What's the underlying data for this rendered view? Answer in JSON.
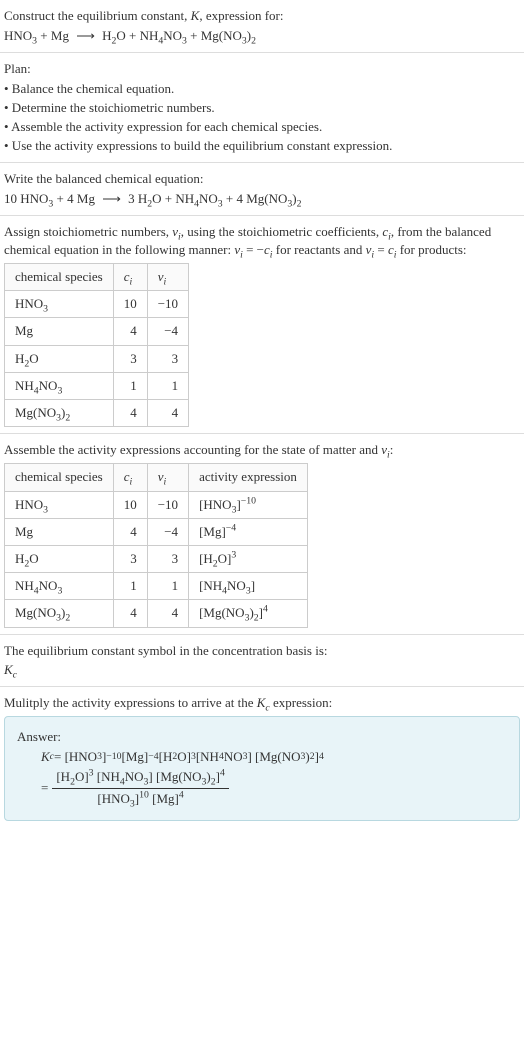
{
  "sec1": {
    "title_a": "Construct the equilibrium constant, ",
    "title_b": ", expression for:",
    "eq_lhs_1": "HNO",
    "eq_lhs_2": " + Mg ",
    "eq_rhs_1": " H",
    "eq_rhs_2": "O + NH",
    "eq_rhs_3": "NO",
    "eq_rhs_4": " + Mg(NO",
    "eq_rhs_5": ")"
  },
  "sec2": {
    "title": "Plan:",
    "b1": "• Balance the chemical equation.",
    "b2": "• Determine the stoichiometric numbers.",
    "b3": "• Assemble the activity expression for each chemical species.",
    "b4": "• Use the activity expressions to build the equilibrium constant expression."
  },
  "sec3": {
    "title": "Write the balanced chemical equation:",
    "eq_a": "10 HNO",
    "eq_b": " + 4 Mg ",
    "eq_c": " 3 H",
    "eq_d": "O + NH",
    "eq_e": "NO",
    "eq_f": " + 4 Mg(NO",
    "eq_g": ")"
  },
  "sec4": {
    "p1a": "Assign stoichiometric numbers, ",
    "p1b": ", using the stoichiometric coefficients, ",
    "p1c": ", from the balanced chemical equation in the following manner: ",
    "p1d": " = −",
    "p1e": " for reactants and ",
    "p1f": " = ",
    "p1g": " for products:",
    "h1": "chemical species",
    "rows": [
      {
        "sp": "HNO",
        "sub": "3",
        "c": "10",
        "v": "−10"
      },
      {
        "sp": "Mg",
        "sub": "",
        "c": "4",
        "v": "−4"
      },
      {
        "sp": "H",
        "sub": "2",
        "sp2": "O",
        "c": "3",
        "v": "3"
      },
      {
        "sp": "NH",
        "sub": "4",
        "sp2": "NO",
        "sub2": "3",
        "c": "1",
        "v": "1"
      },
      {
        "sp": "Mg(NO",
        "sub": "3",
        "sp2": ")",
        "sub2": "2",
        "c": "4",
        "v": "4"
      }
    ]
  },
  "sec5": {
    "title_a": "Assemble the activity expressions accounting for the state of matter and ",
    "title_b": ":",
    "h1": "chemical species",
    "h4": "activity expression",
    "rows": [
      {
        "sp": "HNO",
        "sub": "3",
        "c": "10",
        "v": "−10",
        "act_a": "[HNO",
        "act_sub": "3",
        "act_b": "]",
        "act_sup": "−10"
      },
      {
        "sp": "Mg",
        "sub": "",
        "c": "4",
        "v": "−4",
        "act_a": "[Mg]",
        "act_sup": "−4"
      },
      {
        "sp": "H",
        "sub": "2",
        "sp2": "O",
        "c": "3",
        "v": "3",
        "act_a": "[H",
        "act_sub": "2",
        "act_b": "O]",
        "act_sup": "3"
      },
      {
        "sp": "NH",
        "sub": "4",
        "sp2": "NO",
        "sub2": "3",
        "c": "1",
        "v": "1",
        "act_a": "[NH",
        "act_sub": "4",
        "act_b": "NO",
        "act_sub2": "3",
        "act_c": "]"
      },
      {
        "sp": "Mg(NO",
        "sub": "3",
        "sp2": ")",
        "sub2": "2",
        "c": "4",
        "v": "4",
        "act_a": "[Mg(NO",
        "act_sub": "3",
        "act_b": ")",
        "act_sub2": "2",
        "act_c": "]",
        "act_sup": "4"
      }
    ]
  },
  "sec6": {
    "l1": "The equilibrium constant symbol in the concentration basis is:"
  },
  "sec7": {
    "title_a": "Mulitply the activity expressions to arrive at the ",
    "title_b": " expression:",
    "answer": "Answer:",
    "eq1_a": " = [HNO",
    "eq1_b": "]",
    "eq1_c": " [Mg]",
    "eq1_d": " [H",
    "eq1_e": "O]",
    "eq1_f": " [NH",
    "eq1_g": "NO",
    "eq1_h": "] [Mg(NO",
    "eq1_i": ")",
    "eq1_j": "]",
    "eq2_eq": " = ",
    "num_a": "[H",
    "num_b": "O]",
    "num_c": " [NH",
    "num_d": "NO",
    "num_e": "] [Mg(NO",
    "num_f": ")",
    "num_g": "]",
    "den_a": "[HNO",
    "den_b": "]",
    "den_c": " [Mg]"
  },
  "sym": {
    "K": "K",
    "Kc": "K",
    "c": "c",
    "v": "ν",
    "i": "i",
    "ci": "c",
    "arrow": "⟶",
    "three": "3",
    "two": "2",
    "four": "4",
    "neg10": "−10",
    "neg4": "−4",
    "ten": "10"
  }
}
